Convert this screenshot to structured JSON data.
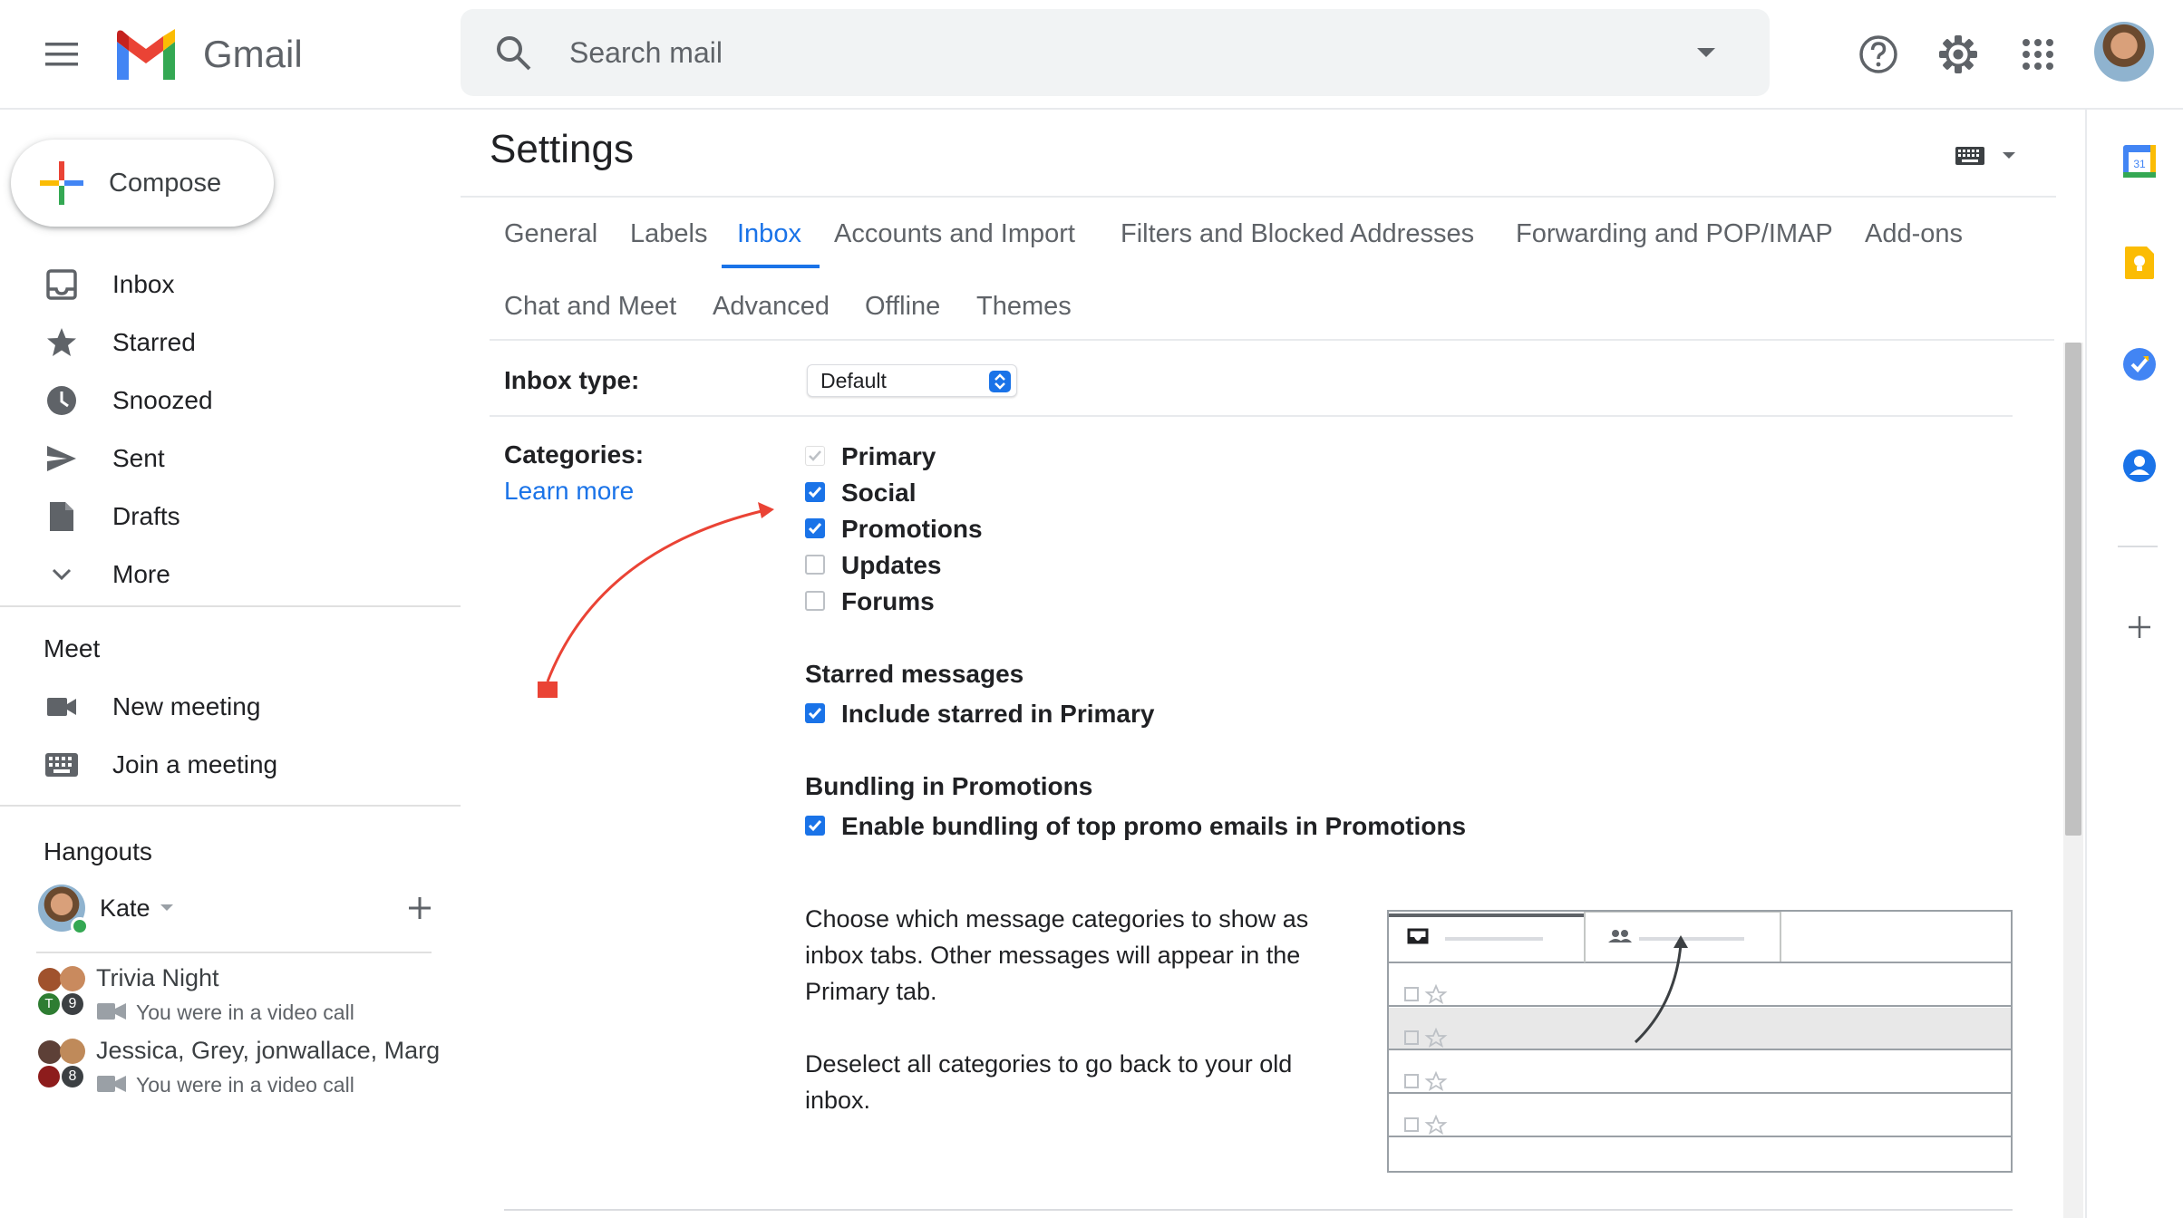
{
  "header": {
    "app_name": "Gmail",
    "search_placeholder": "Search mail"
  },
  "sidebar": {
    "compose_label": "Compose",
    "items": [
      {
        "label": "Inbox",
        "icon": "inbox-icon"
      },
      {
        "label": "Starred",
        "icon": "star-icon"
      },
      {
        "label": "Snoozed",
        "icon": "clock-icon"
      },
      {
        "label": "Sent",
        "icon": "send-icon"
      },
      {
        "label": "Drafts",
        "icon": "draft-icon"
      },
      {
        "label": "More",
        "icon": "chevron-down-icon"
      }
    ],
    "meet": {
      "title": "Meet",
      "items": [
        {
          "label": "New meeting",
          "icon": "video-icon"
        },
        {
          "label": "Join a meeting",
          "icon": "keyboard-icon"
        }
      ]
    },
    "hangouts": {
      "title": "Hangouts",
      "user": "Kate",
      "conversations": [
        {
          "title": "Trivia Night",
          "subtitle": "You were in a video call",
          "count": "9",
          "initial": "T"
        },
        {
          "title": "Jessica, Grey, jonwallace, Marg",
          "subtitle": "You were in a video call",
          "count": "8"
        }
      ]
    }
  },
  "settings": {
    "title": "Settings",
    "tabs_row1": [
      "General",
      "Labels",
      "Inbox",
      "Accounts and Import",
      "Filters and Blocked Addresses",
      "Forwarding and POP/IMAP",
      "Add-ons"
    ],
    "tabs_row2": [
      "Chat and Meet",
      "Advanced",
      "Offline",
      "Themes"
    ],
    "active_tab": "Inbox",
    "inbox_type": {
      "label": "Inbox type:",
      "value": "Default"
    },
    "categories": {
      "label": "Categories:",
      "learn_more": "Learn more",
      "items": [
        {
          "label": "Primary",
          "checked": true,
          "disabled": true
        },
        {
          "label": "Social",
          "checked": true,
          "disabled": false
        },
        {
          "label": "Promotions",
          "checked": true,
          "disabled": false
        },
        {
          "label": "Updates",
          "checked": false,
          "disabled": false
        },
        {
          "label": "Forums",
          "checked": false,
          "disabled": false
        }
      ]
    },
    "starred": {
      "heading": "Starred messages",
      "option": "Include starred in Primary",
      "checked": true
    },
    "bundling": {
      "heading": "Bundling in Promotions",
      "option": "Enable bundling of top promo emails in Promotions",
      "checked": true
    },
    "description_1": "Choose which message categories to show as inbox tabs. Other messages will appear in the Primary tab.",
    "description_2": "Deselect all categories to go back to your old inbox."
  },
  "colors": {
    "accent": "#1a73e8",
    "annotation_arrow": "#ea4335"
  }
}
